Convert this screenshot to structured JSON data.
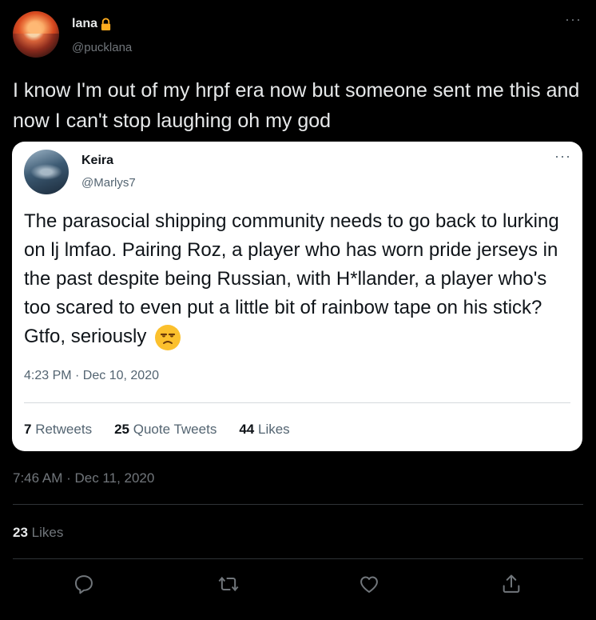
{
  "author": {
    "display_name": "lana",
    "handle": "@pucklana"
  },
  "tweet": {
    "text": "I know I'm out of my hrpf era now but someone sent me this and now I can't stop laughing oh my god",
    "timestamp": "7:46 AM · Dec 11, 2020",
    "likes_count": "23",
    "likes_label": "Likes"
  },
  "quote": {
    "display_name": "Keira",
    "handle": "@Marlys7",
    "text": "The parasocial shipping community needs to go back to lurking on lj lmfao. Pairing Roz, a player who has worn pride jerseys in the past despite being Russian, with H*llander, a player who's too scared to even put a little bit of rainbow tape on his stick? Gtfo, seriously",
    "timestamp": "4:23 PM · Dec 10, 2020",
    "stats": {
      "retweets_count": "7",
      "retweets_label": "Retweets",
      "quote_tweets_count": "25",
      "quote_tweets_label": "Quote Tweets",
      "likes_count": "44",
      "likes_label": "Likes"
    }
  },
  "more_glyph": "···",
  "icons": [
    "lock-icon",
    "more-icon",
    "reply-icon",
    "retweet-icon",
    "like-icon",
    "share-icon",
    "unamused-emoji"
  ],
  "colors": {
    "background": "#000000",
    "text": "#e7e9ea",
    "muted": "#71767b",
    "divider": "#2f3336",
    "lock": "#ffad1f",
    "emoji": "#fbc02d"
  }
}
